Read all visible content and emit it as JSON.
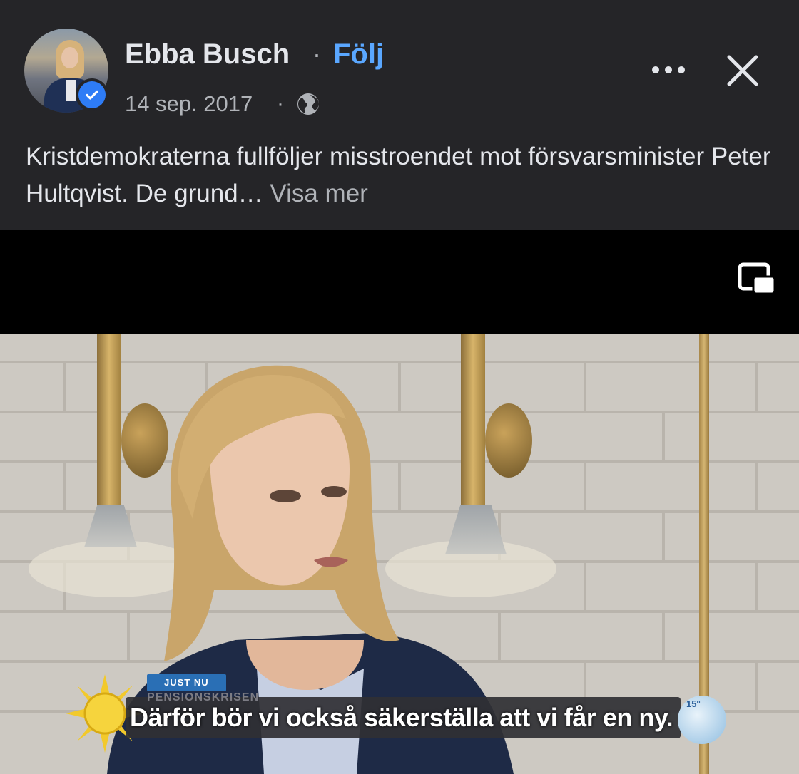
{
  "post": {
    "author": "Ebba Busch",
    "follow_label": "Följ",
    "separator": "·",
    "date": "14 sep. 2017",
    "text": "Kristdemokraterna fullföljer misstroendet mot försvarsminister Peter Hultqvist. De grund…",
    "see_more": "Visa mer"
  },
  "icons": {
    "verified": "verified-badge-icon",
    "privacy": "globe-icon",
    "more": "more-options-icon",
    "close": "close-icon",
    "pip": "picture-in-picture-icon"
  },
  "video": {
    "overlay_tag": "JUST NU",
    "overlay_label": "PENSIONSKRISEN",
    "caption": "Därför bör vi också säkerställa att vi får en ny.",
    "weather_temp": "15°"
  },
  "colors": {
    "background": "#252528",
    "accent": "#5aa7ff",
    "verified": "#2e7cf6"
  }
}
